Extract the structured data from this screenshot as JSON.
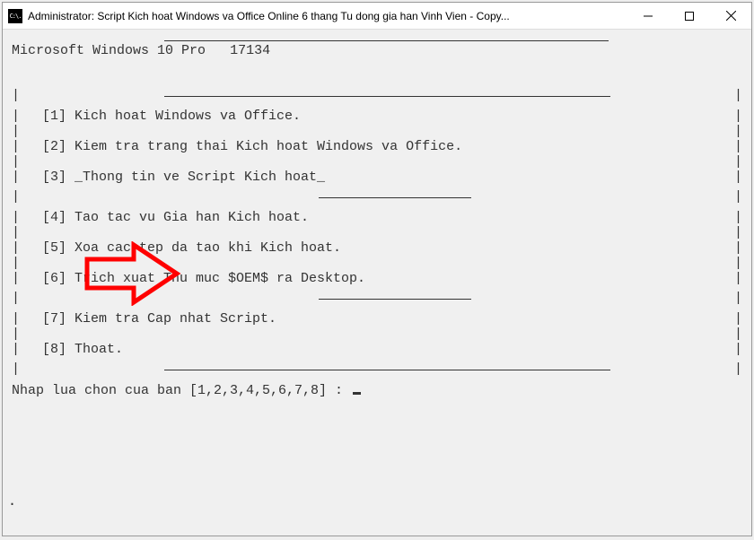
{
  "titlebar": {
    "title": "Administrator:  Script Kich hoat Windows va Office Online 6 thang Tu dong gia han Vinh Vien - Copy...",
    "icon_name": "cmd-icon"
  },
  "controls": {
    "minimize": "Minimize",
    "maximize": "Maximize",
    "close": "Close"
  },
  "console": {
    "os_name": "Microsoft Windows 10 Pro",
    "os_build": "17134",
    "menu": {
      "1": "[1] Kich hoat Windows va Office.",
      "2": "[2] Kiem tra trang thai Kich hoat Windows va Office.",
      "3": "[3] _Thong tin ve Script Kich hoat_",
      "4": "[4] Tao tac vu Gia han Kich hoat.",
      "5": "[5] Xoa cac tep da tao khi Kich hoat.",
      "6": "[6] Trich xuat Thu muc $OEM$ ra Desktop.",
      "7": "[7] Kiem tra Cap nhat Script.",
      "8": "[8] Thoat."
    },
    "prompt_label": "Nhap lua chon cua ban [1,2,3,4,5,6,7,8] :",
    "prompt_value": ""
  },
  "annotation": {
    "arrow_target": "menu-item-4",
    "arrow_color": "#ff0000"
  }
}
